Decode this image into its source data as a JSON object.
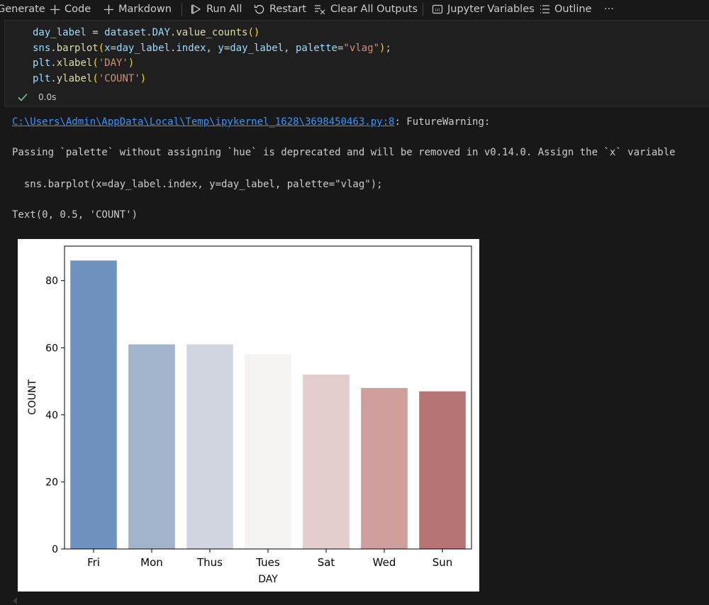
{
  "toolbar": {
    "generate_label": "Generate",
    "code_label": "Code",
    "markdown_label": "Markdown",
    "run_all_label": "Run All",
    "restart_label": "Restart",
    "clear_outputs_label": "Clear All Outputs",
    "variables_label": "Jupyter Variables",
    "outline_label": "Outline",
    "more_label": "···"
  },
  "cell": {
    "code_lines": [
      "day_label = dataset.DAY.value_counts()",
      "sns.barplot(x=day_label.index, y=day_label, palette=\"vlag\");",
      "plt.xlabel('DAY')",
      "plt.ylabel('COUNT')"
    ],
    "execution_time": "0.0s"
  },
  "output": {
    "warning_link": "C:\\Users\\Admin\\AppData\\Local\\Temp\\ipykernel_1628\\3698450463.py:8",
    "warning_suffix": ": FutureWarning:",
    "warning_message": "Passing `palette` without assigning `hue` is deprecated and will be removed in v0.14.0. Assign the `x` variable",
    "warning_code": "  sns.barplot(x=day_label.index, y=day_label, palette=\"vlag\");",
    "result_text": "Text(0, 0.5, 'COUNT')"
  },
  "colors": {
    "background": "#181818",
    "cell_background": "#1f1f1f",
    "link": "#3794ff",
    "check": "#73c991"
  },
  "chart_data": {
    "type": "bar",
    "categories": [
      "Fri",
      "Mon",
      "Thus",
      "Tues",
      "Sat",
      "Wed",
      "Sun"
    ],
    "values": [
      86,
      61,
      61,
      58,
      52,
      48,
      47
    ],
    "bar_colors": [
      "#7092be",
      "#a2b4cb",
      "#d1d6e1",
      "#f6f4f3",
      "#e3cdcd",
      "#d09f9d",
      "#b77475"
    ],
    "xlabel": "DAY",
    "ylabel": "COUNT",
    "yticks": [
      0,
      20,
      40,
      60,
      80
    ],
    "ylim": [
      0,
      90.3
    ],
    "grid": false
  }
}
